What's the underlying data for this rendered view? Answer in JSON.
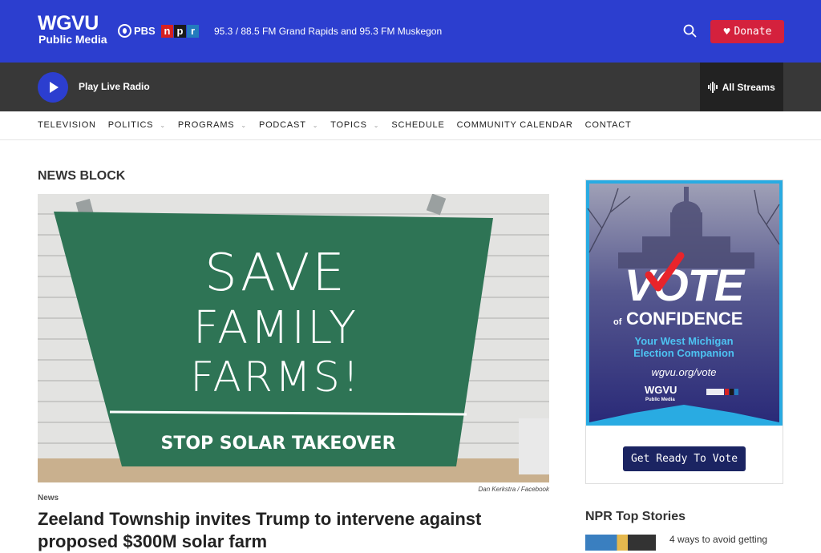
{
  "header": {
    "logo_main": "WGVU",
    "logo_sub": "Public Media",
    "pbs_label": "PBS",
    "npr_letters": [
      "n",
      "p",
      "r"
    ],
    "tagline": "95.3 / 88.5 FM Grand Rapids and 95.3 FM Muskegon",
    "search_icon": "search-icon",
    "donate_label": "Donate",
    "colors": {
      "bar": "#2c3ecf",
      "donate": "#d4213d"
    }
  },
  "player": {
    "play_label": "Play Live Radio",
    "streams_label": "All Streams"
  },
  "nav": {
    "items": [
      {
        "label": "TELEVISION",
        "dropdown": false
      },
      {
        "label": "POLITICS",
        "dropdown": true
      },
      {
        "label": "PROGRAMS",
        "dropdown": true
      },
      {
        "label": "PODCAST",
        "dropdown": true
      },
      {
        "label": "TOPICS",
        "dropdown": true
      },
      {
        "label": "SCHEDULE",
        "dropdown": false
      },
      {
        "label": "COMMUNITY CALENDAR",
        "dropdown": false
      },
      {
        "label": "CONTACT",
        "dropdown": false
      }
    ]
  },
  "main": {
    "section_title": "NEWS BLOCK",
    "hero_sign": {
      "line1": "SAVE",
      "line2": "FAMILY",
      "line3": "FARMS!",
      "line4": "STOP SOLAR TAKEOVER"
    },
    "credit": "Dan Kerkstra / Facebook",
    "kicker": "News",
    "headline": "Zeeland Township invites Trump to intervene against proposed $300M solar farm"
  },
  "sidebar": {
    "ad": {
      "vote_word": "VOTE",
      "of_label": "of",
      "confidence": "CONFIDENCE",
      "line1": "Your West Michigan",
      "line2": "Election Companion",
      "url": "wgvu.org/vote",
      "brand_main": "WGVU",
      "brand_sub": "Public Media"
    },
    "vote_button": "Get Ready To Vote",
    "npr_title": "NPR Top Stories",
    "npr_first_link": "4 ways to avoid getting"
  }
}
